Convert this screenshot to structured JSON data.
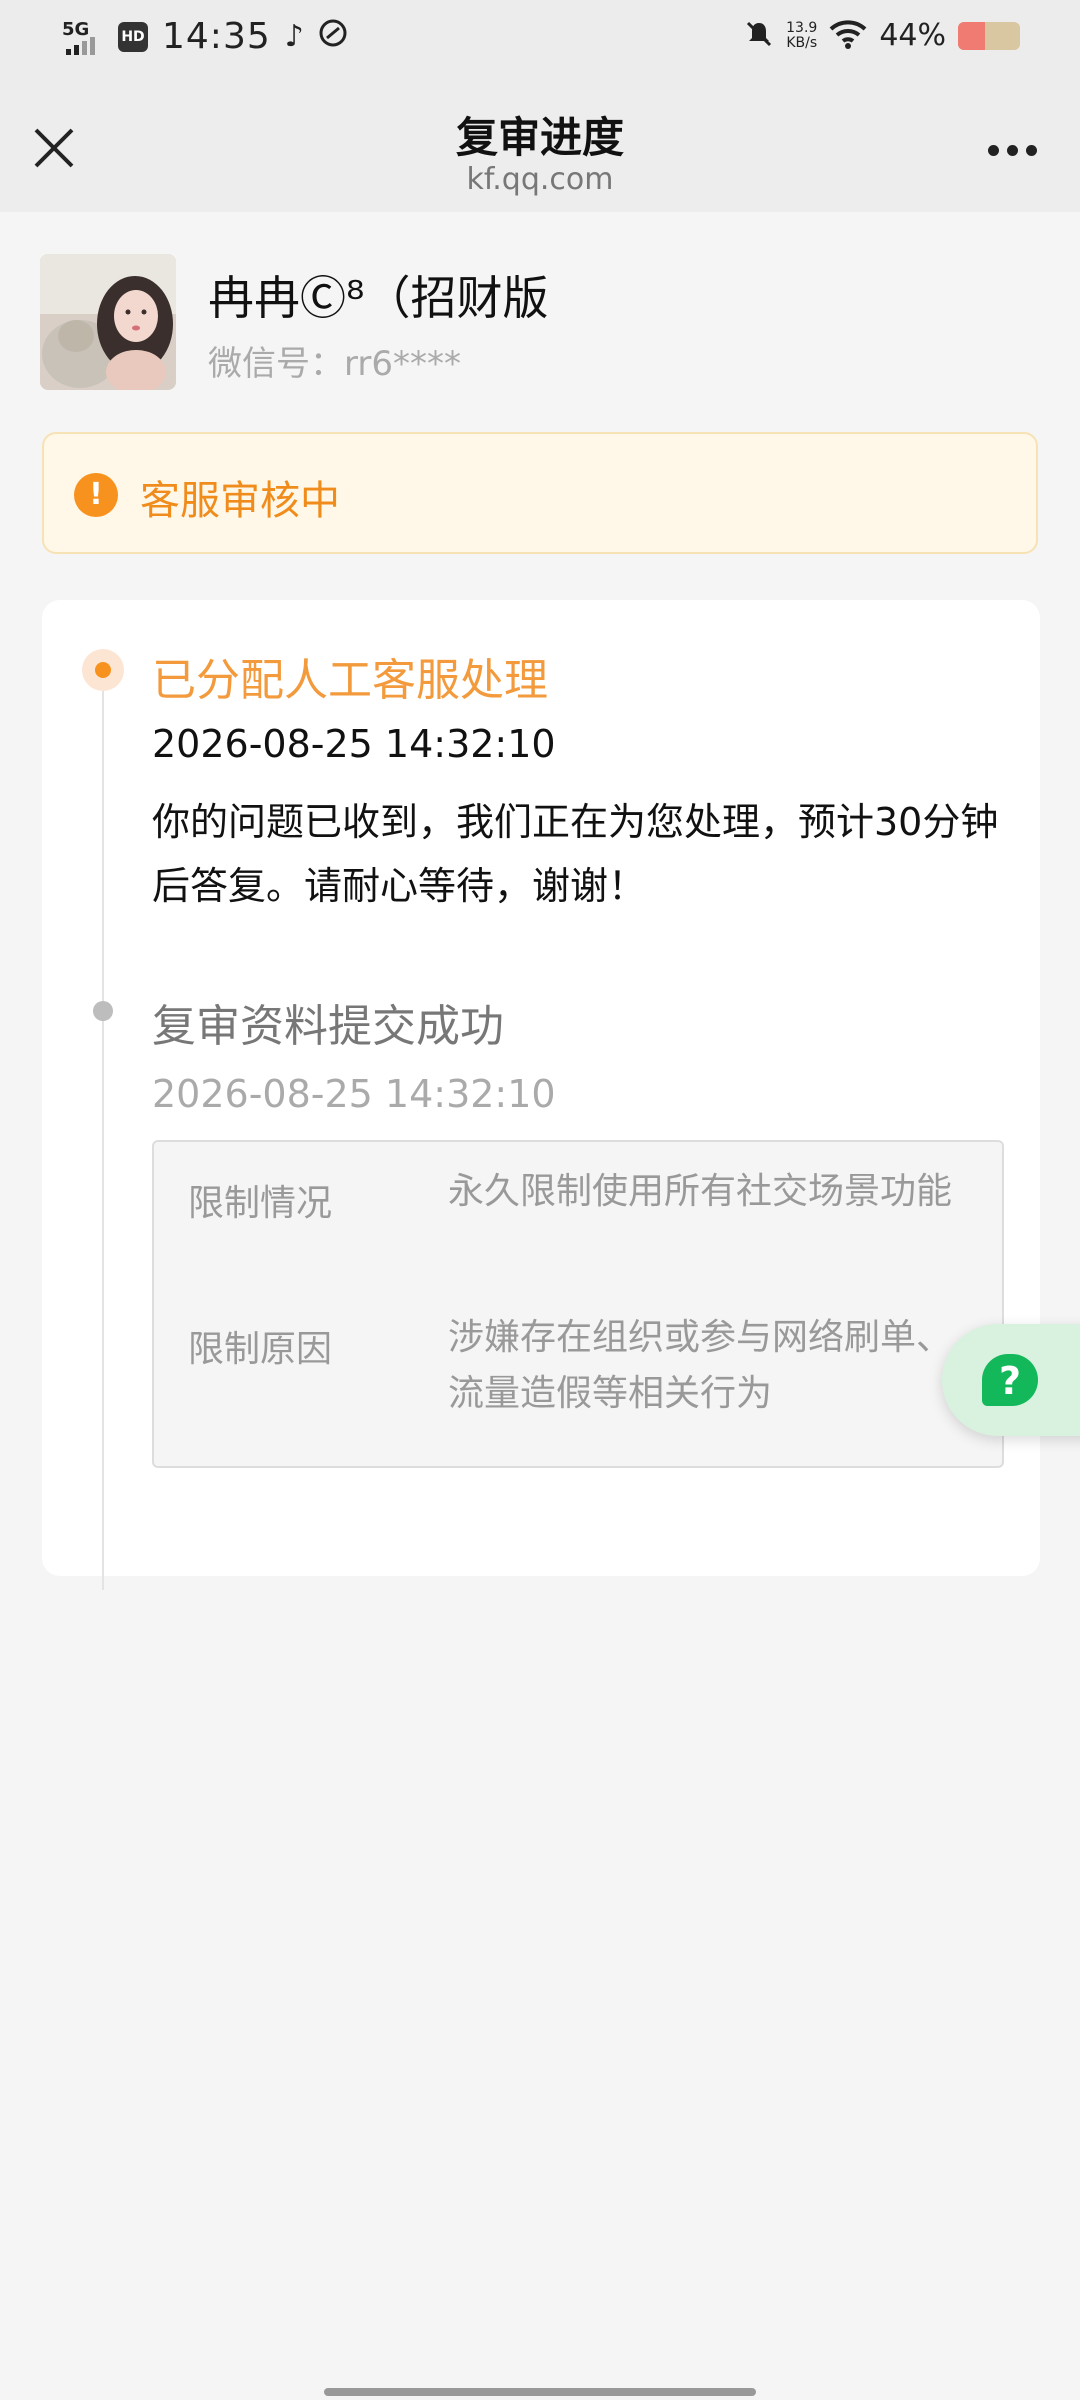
{
  "status_bar": {
    "network": "5G",
    "hd": "HD",
    "time": "14:35",
    "app_icons": [
      "tiktok-icon",
      "app-icon"
    ],
    "net_speed_value": "13.9",
    "net_speed_unit": "KB/s",
    "battery_pct": "44%",
    "battery_level": 0.44
  },
  "header": {
    "title": "复审进度",
    "subtitle": "kf.qq.com"
  },
  "profile": {
    "name": "冉冉Ⓒ⁸（招财版",
    "wechat_id": "微信号：rr6****"
  },
  "banner": {
    "icon": "!",
    "text": "客服审核中",
    "accent": "#f08c1c"
  },
  "timeline": {
    "steps": [
      {
        "title": "已分配人工客服处理",
        "time": "2026-08-25 14:32:10",
        "description": "你的问题已收到，我们正在为您处理，预计30分钟后答复。请耐心等待，谢谢！",
        "status": "active"
      },
      {
        "title": "复审资料提交成功",
        "time": "2026-08-25 14:32:10",
        "status": "done"
      }
    ],
    "restrictions": [
      {
        "label": "限制情况",
        "value": "永久限制使用所有社交场景功能"
      },
      {
        "label": "限制原因",
        "value": "涉嫌存在组织或参与网络刷单、流量造假等相关行为"
      }
    ]
  },
  "help_fab": {
    "icon": "?"
  }
}
